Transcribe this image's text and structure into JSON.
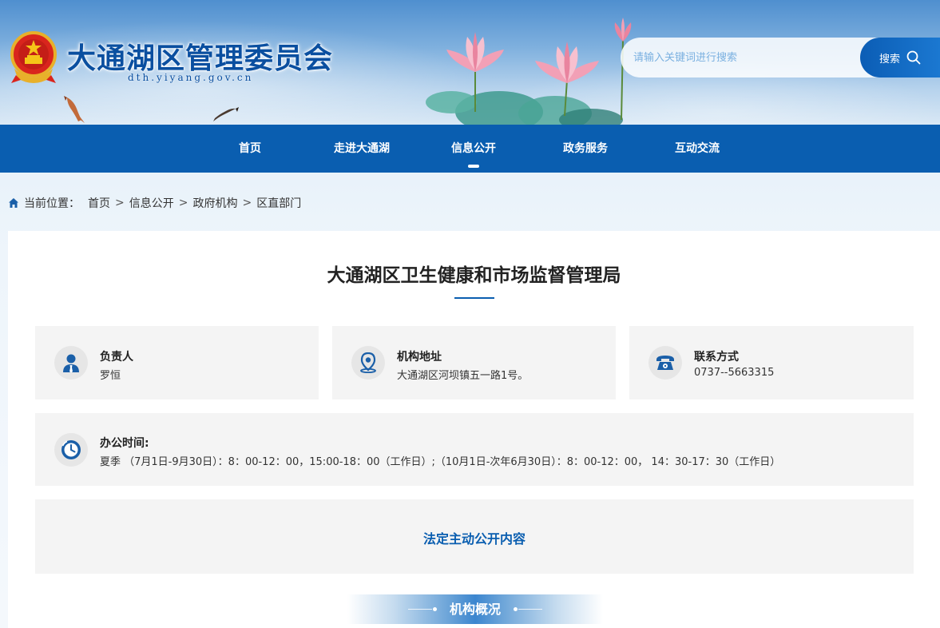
{
  "header": {
    "site_title": "大通湖区管理委员会",
    "site_domain": "dth.yiyang.gov.cn",
    "search_placeholder": "请输入关键词进行搜索",
    "search_button": "搜索"
  },
  "nav": {
    "items": [
      {
        "label": "首页"
      },
      {
        "label": "走进大通湖"
      },
      {
        "label": "信息公开"
      },
      {
        "label": "政务服务"
      },
      {
        "label": "互动交流"
      }
    ],
    "active_index": 2
  },
  "breadcrumb": {
    "prefix": "当前位置：",
    "items": [
      "首页",
      "信息公开",
      "政府机构",
      "区直部门"
    ],
    "separator": ">"
  },
  "org": {
    "title": "大通湖区卫生健康和市场监督管理局",
    "leader_label": "负责人",
    "leader_value": "罗恒",
    "address_label": "机构地址",
    "address_value": "大通湖区河坝镇五一路1号。",
    "contact_label": "联系方式",
    "contact_value": "0737--5663315",
    "hours_label": "办公时间:",
    "hours_value": "夏季 （7月1日-9月30日）：8：00-12：00，15:00-18：00（工作日）;（10月1日-次年6月30日）：8：00-12：00， 14：30-17：30（工作日）",
    "legal_link": "法定主动公开内容",
    "section_title": "机构概况"
  },
  "colors": {
    "primary": "#0a5eb0",
    "card_bg": "#f4f4f4",
    "icon_blue": "#1a5fa8"
  }
}
